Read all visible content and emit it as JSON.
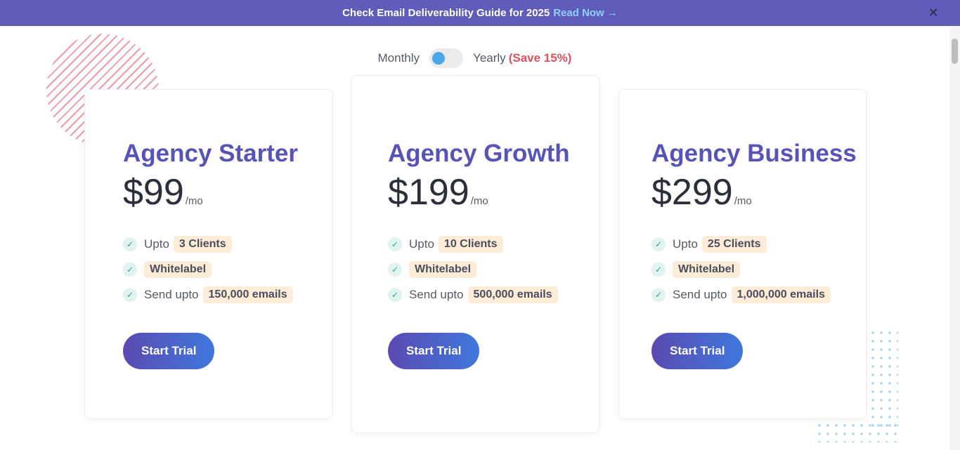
{
  "banner": {
    "text": "Check Email Deliverability Guide for 2025",
    "link_text": "Read Now →",
    "close_icon": "✕"
  },
  "billing_toggle": {
    "monthly_label": "Monthly",
    "yearly_label": "Yearly",
    "save_label": "(Save 15%)",
    "selected": "Monthly"
  },
  "plans": [
    {
      "name": "Agency Starter",
      "price": "$99",
      "period": "/mo",
      "features": [
        {
          "prefix": "Upto",
          "highlight": "3 Clients"
        },
        {
          "prefix": "",
          "highlight": "Whitelabel"
        },
        {
          "prefix": "Send upto",
          "highlight": "150,000 emails"
        }
      ],
      "cta": "Start Trial"
    },
    {
      "name": "Agency Growth",
      "price": "$199",
      "period": "/mo",
      "features": [
        {
          "prefix": "Upto",
          "highlight": "10 Clients"
        },
        {
          "prefix": "",
          "highlight": "Whitelabel"
        },
        {
          "prefix": "Send upto",
          "highlight": "500,000 emails"
        }
      ],
      "cta": "Start Trial"
    },
    {
      "name": "Agency Business",
      "price": "$299",
      "period": "/mo",
      "features": [
        {
          "prefix": "Upto",
          "highlight": "25 Clients"
        },
        {
          "prefix": "",
          "highlight": "Whitelabel"
        },
        {
          "prefix": "Send upto",
          "highlight": "1,000,000 emails"
        }
      ],
      "cta": "Start Trial"
    }
  ],
  "colors": {
    "banner_bg": "#5f5db9",
    "accent": "#5854b5",
    "save": "#d9525e",
    "pill_bg": "#fdecd8",
    "check": "#3aa98a"
  },
  "icons": {
    "check": "check-icon",
    "close": "close-icon"
  }
}
